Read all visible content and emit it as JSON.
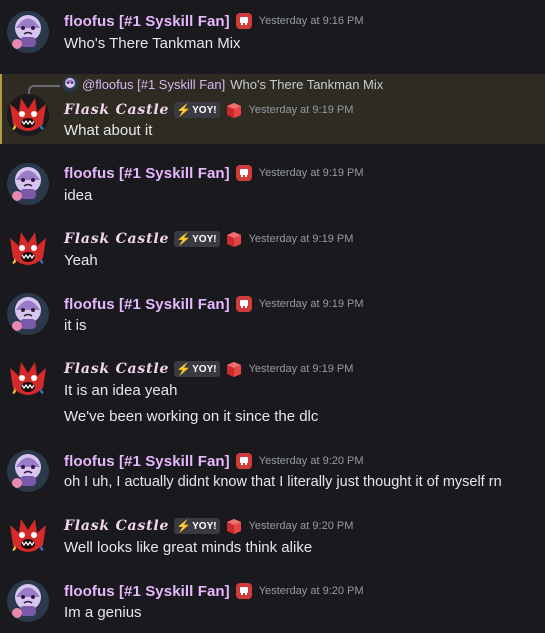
{
  "colors": {
    "background": "#1a1a1e",
    "floofus_name": "#e6b8ff",
    "flask_name": "#f2d6ee",
    "timestamp": "#949ba4",
    "highlight": "#2e2b22"
  },
  "icons": {
    "floofus_avatar": "purple-ghost-avatar-icon",
    "flask_avatar": "red-flame-creature-avatar-icon",
    "badge": "red-cube-badge-icon",
    "bolt": "lightning-bolt-icon"
  },
  "reply": {
    "author": "@floofus [#1 Syskill Fan]",
    "text": "Who's There Tankman Mix"
  },
  "messages": [
    {
      "author": "floofus [#1 Syskill Fan]",
      "timestamp": "Yesterday at 9:16 PM",
      "lines": [
        "Who's There Tankman Mix"
      ]
    },
    {
      "author": "Flask Castle",
      "tag": "YOY!",
      "timestamp": "Yesterday at 9:19 PM",
      "lines": [
        "What about it"
      ]
    },
    {
      "author": "floofus [#1 Syskill Fan]",
      "timestamp": "Yesterday at 9:19 PM",
      "lines": [
        "idea"
      ]
    },
    {
      "author": "Flask Castle",
      "tag": "YOY!",
      "timestamp": "Yesterday at 9:19 PM",
      "lines": [
        "Yeah"
      ]
    },
    {
      "author": "floofus [#1 Syskill Fan]",
      "timestamp": "Yesterday at 9:19 PM",
      "lines": [
        "it is"
      ]
    },
    {
      "author": "Flask Castle",
      "tag": "YOY!",
      "timestamp": "Yesterday at 9:19 PM",
      "lines": [
        "It is an idea yeah",
        "We've been working on it since the dlc"
      ]
    },
    {
      "author": "floofus [#1 Syskill Fan]",
      "timestamp": "Yesterday at 9:20 PM",
      "lines": [
        "oh I uh, I actually didnt know that I literally just thought it of myself rn"
      ]
    },
    {
      "author": "Flask Castle",
      "tag": "YOY!",
      "timestamp": "Yesterday at 9:20 PM",
      "lines": [
        "Well looks like great minds think alike"
      ]
    },
    {
      "author": "floofus [#1 Syskill Fan]",
      "timestamp": "Yesterday at 9:20 PM",
      "lines": [
        "Im a genius"
      ]
    }
  ]
}
